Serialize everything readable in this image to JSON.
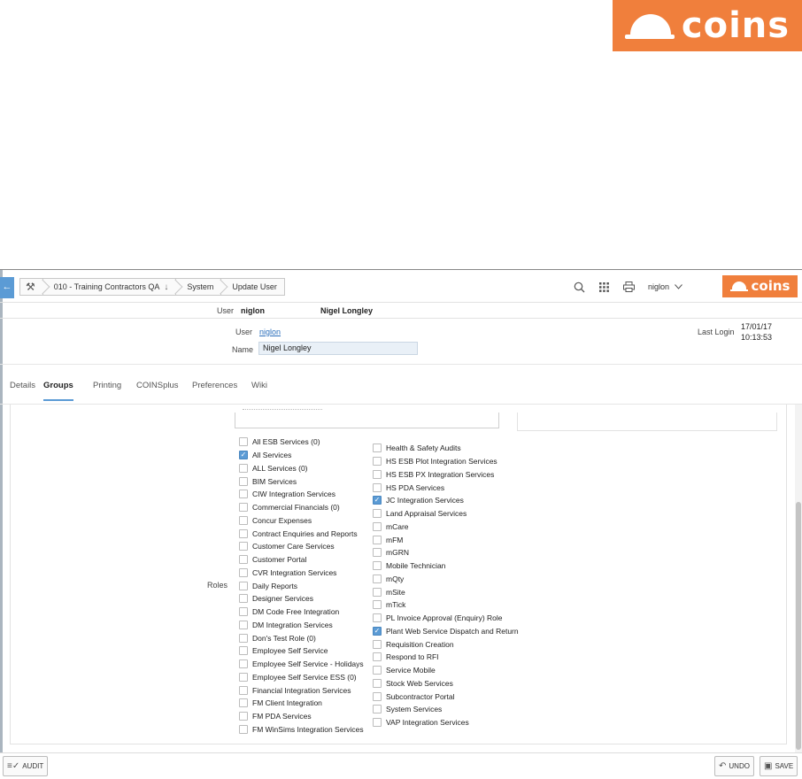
{
  "branding": {
    "logo_text": "coins",
    "brand_color": "#f07f3c",
    "accent_color": "#5b9bd5"
  },
  "topbar": {
    "back_icon": "←",
    "breadcrumbs": [
      {
        "label": "010 - Training Contractors QA",
        "icon": "↓"
      },
      {
        "label": "System"
      },
      {
        "label": "Update User"
      }
    ],
    "username": "niglon"
  },
  "userbar": {
    "label": "User",
    "code": "niglon",
    "full_name": "Nigel Longley"
  },
  "form": {
    "user_label": "User",
    "user_value": "niglon",
    "name_label": "Name",
    "name_value": "Nigel Longley",
    "last_login_label": "Last Login",
    "last_login_date": "17/01/17",
    "last_login_time": "10:13:53"
  },
  "tabs": [
    "Details",
    "Groups",
    "Printing",
    "COINSplus",
    "Preferences",
    "Wiki"
  ],
  "active_tab": "Groups",
  "roles": {
    "label": "Roles",
    "column1": [
      {
        "label": "All ESB Services (0)",
        "checked": false
      },
      {
        "label": "All Services",
        "checked": true
      },
      {
        "label": "ALL Services (0)",
        "checked": false
      },
      {
        "label": "BIM Services",
        "checked": false
      },
      {
        "label": "CIW Integration Services",
        "checked": false
      },
      {
        "label": "Commercial Financials (0)",
        "checked": false
      },
      {
        "label": "Concur Expenses",
        "checked": false
      },
      {
        "label": "Contract Enquiries and Reports",
        "checked": false
      },
      {
        "label": "Customer Care Services",
        "checked": false
      },
      {
        "label": "Customer Portal",
        "checked": false
      },
      {
        "label": "CVR Integration Services",
        "checked": false
      },
      {
        "label": "Daily Reports",
        "checked": false
      },
      {
        "label": "Designer Services",
        "checked": false
      },
      {
        "label": "DM Code Free Integration",
        "checked": false
      },
      {
        "label": "DM Integration Services",
        "checked": false
      },
      {
        "label": "Don's Test Role (0)",
        "checked": false
      },
      {
        "label": "Employee Self Service",
        "checked": false
      },
      {
        "label": "Employee Self Service - Holidays",
        "checked": false
      },
      {
        "label": "Employee Self Service ESS (0)",
        "checked": false
      },
      {
        "label": "Financial Integration Services",
        "checked": false
      },
      {
        "label": "FM Client Integration",
        "checked": false
      },
      {
        "label": "FM PDA Services",
        "checked": false
      },
      {
        "label": "FM WinSims Integration Services",
        "checked": false
      }
    ],
    "column2": [
      {
        "label": "Health & Safety Audits",
        "checked": false
      },
      {
        "label": "HS ESB Plot Integration Services",
        "checked": false
      },
      {
        "label": "HS ESB PX Integration Services",
        "checked": false
      },
      {
        "label": "HS PDA Services",
        "checked": false
      },
      {
        "label": "JC Integration Services",
        "checked": true
      },
      {
        "label": "Land Appraisal Services",
        "checked": false
      },
      {
        "label": "mCare",
        "checked": false
      },
      {
        "label": "mFM",
        "checked": false
      },
      {
        "label": "mGRN",
        "checked": false
      },
      {
        "label": "Mobile Technician",
        "checked": false
      },
      {
        "label": "mQty",
        "checked": false
      },
      {
        "label": "mSite",
        "checked": false
      },
      {
        "label": "mTick",
        "checked": false
      },
      {
        "label": "PL Invoice Approval (Enquiry) Role",
        "checked": false
      },
      {
        "label": "Plant Web Service Dispatch and Return",
        "checked": true
      },
      {
        "label": "Requisition Creation",
        "checked": false
      },
      {
        "label": "Respond to RFI",
        "checked": false
      },
      {
        "label": "Service Mobile",
        "checked": false
      },
      {
        "label": "Stock Web Services",
        "checked": false
      },
      {
        "label": "Subcontractor Portal",
        "checked": false
      },
      {
        "label": "System Services",
        "checked": false
      },
      {
        "label": "VAP Integration Services",
        "checked": false
      }
    ]
  },
  "footer": {
    "audit_label": "AUDIT",
    "undo_label": "UNDO",
    "save_label": "SAVE"
  }
}
